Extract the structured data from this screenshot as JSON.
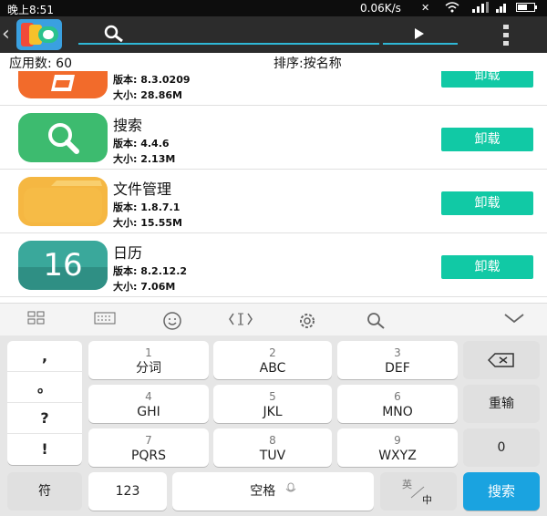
{
  "status": {
    "time": "晚上8:51",
    "speed": "0.06K/s"
  },
  "info": {
    "count": "应用数:  60",
    "sort": "排序:按名称"
  },
  "apps": [
    {
      "name": "",
      "version": "版本:  8.3.0209",
      "size": "大小:  28.86M",
      "button": "卸载",
      "color": "#f26b2b"
    },
    {
      "name": "搜索",
      "version": "版本:  4.4.6",
      "size": "大小:  2.13M",
      "button": "卸载",
      "color": "#3dbb6f"
    },
    {
      "name": "文件管理",
      "version": "版本:  1.8.7.1",
      "size": "大小:  15.55M",
      "button": "卸载",
      "color": "#f5b742"
    },
    {
      "name": "日历",
      "version": "版本:  8.2.12.2",
      "size": "大小:  7.06M",
      "button": "卸载",
      "color": "#3aa89b",
      "icon_text": "16"
    }
  ],
  "punct": [
    ",",
    "。",
    "?",
    "!"
  ],
  "keys": {
    "r1": [
      {
        "num": "1",
        "lbl": "分词"
      },
      {
        "num": "2",
        "lbl": "ABC"
      },
      {
        "num": "3",
        "lbl": "DEF"
      }
    ],
    "r2": [
      {
        "num": "4",
        "lbl": "GHI"
      },
      {
        "num": "5",
        "lbl": "JKL"
      },
      {
        "num": "6",
        "lbl": "MNO"
      }
    ],
    "r3": [
      {
        "num": "7",
        "lbl": "PQRS"
      },
      {
        "num": "8",
        "lbl": "TUV"
      },
      {
        "num": "9",
        "lbl": "WXYZ"
      }
    ],
    "reenter": "重输",
    "zero": "0",
    "symbol": "符",
    "num123": "123",
    "space": "空格",
    "lang_top": "英",
    "lang_bottom": "中",
    "search": "搜索"
  },
  "colors": {
    "accent": "#11c9a5",
    "search_key": "#1aa3e0",
    "toolbar": "#2c2c2c"
  }
}
